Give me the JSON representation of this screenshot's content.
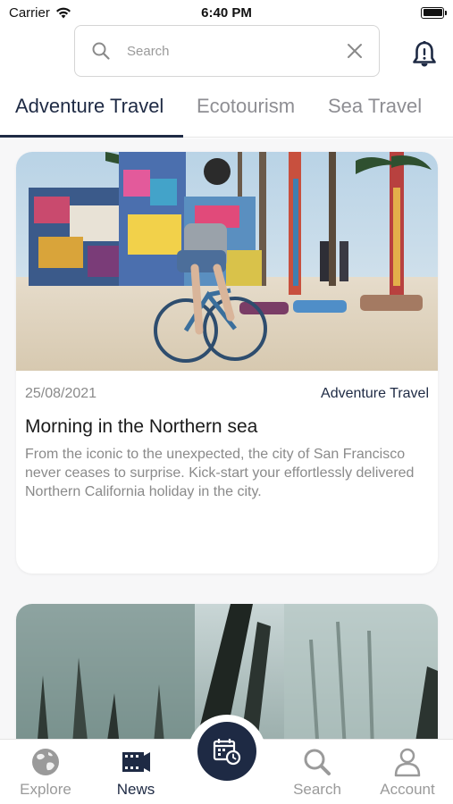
{
  "status_bar": {
    "carrier": "Carrier",
    "time": "6:40 PM"
  },
  "search": {
    "placeholder": "Search",
    "value": ""
  },
  "tabs": [
    {
      "label": "Adventure Travel",
      "active": true
    },
    {
      "label": "Ecotourism",
      "active": false
    },
    {
      "label": "Sea Travel",
      "active": false
    }
  ],
  "feed": {
    "cards": [
      {
        "date": "25/08/2021",
        "category": "Adventure Travel",
        "title": "Morning in the Northern sea",
        "description": " From the iconic to the unexpected, the city of San Francisco never ceases to surprise. Kick-start your effortlessly delivered Northern California holiday in the city."
      },
      {
        "date": "",
        "category": "",
        "title": "",
        "description": ""
      }
    ]
  },
  "bottom_nav": {
    "items": [
      {
        "label": "Explore",
        "icon": "globe-icon",
        "active": false
      },
      {
        "label": "News",
        "icon": "film-icon",
        "active": true
      },
      {
        "label": "",
        "icon": "calendar-clock-icon",
        "active": false
      },
      {
        "label": "Search",
        "icon": "search-icon",
        "active": false
      },
      {
        "label": "Account",
        "icon": "person-icon",
        "active": false
      }
    ]
  },
  "colors": {
    "accent": "#1e2a44",
    "inactive": "#9a9a9a",
    "feed_background": "#f7f7f8"
  }
}
